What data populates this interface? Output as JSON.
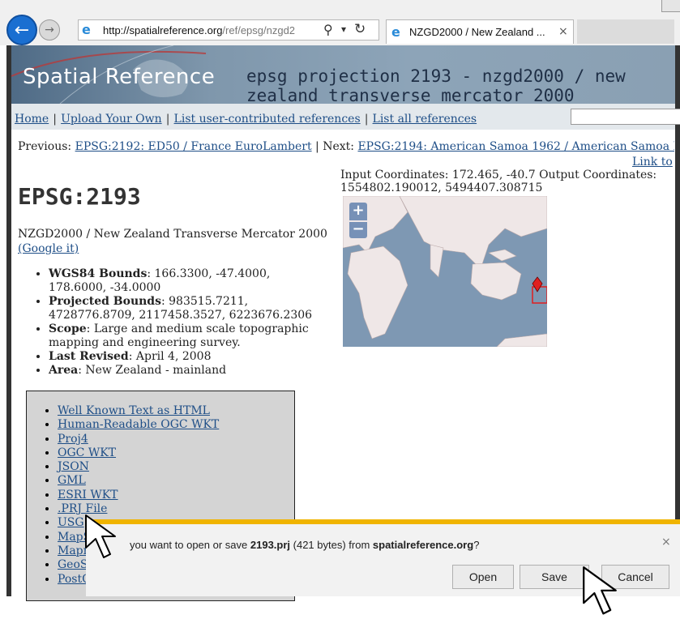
{
  "browser": {
    "url_host": "http://spatialreference.org",
    "url_path": "/ref/epsg/nzgd2",
    "tab_title": "NZGD2000 / New Zealand ...",
    "tab_close": "×"
  },
  "banner": {
    "site_title": "Spatial Reference",
    "heading": "epsg projection 2193 - nzgd2000 / new zealand transverse mercator 2000"
  },
  "nav": {
    "items": [
      {
        "label": "Home"
      },
      {
        "label": "Upload Your Own"
      },
      {
        "label": "List user-contributed references"
      },
      {
        "label": "List all references"
      }
    ],
    "separator": "|"
  },
  "pager": {
    "prev_label": "Previous:",
    "prev_link": "EPSG:2192: ED50 / France EuroLambert",
    "next_label": "| Next:",
    "next_link": "EPSG:2194: American Samoa 1962 / American Samoa Lambert",
    "link_to": "Link to"
  },
  "main": {
    "title": "EPSG:2193",
    "description": "NZGD2000 / New Zealand Transverse Mercator 2000",
    "google": "(Google it)",
    "facts": [
      {
        "key": "WGS84 Bounds",
        "value": ": 166.3300, -47.4000, 178.6000, -34.0000"
      },
      {
        "key": "Projected Bounds",
        "value": ": 983515.7211, 4728776.8709, 2117458.3527, 6223676.2306"
      },
      {
        "key": "Scope",
        "value": ": Large and medium scale topographic mapping and engineering survey."
      },
      {
        "key": "Last Revised",
        "value": ": April 4, 2008"
      },
      {
        "key": "Area",
        "value": ": New Zealand - mainland"
      }
    ],
    "coords": "Input Coordinates: 172.465, -40.7 Output Coordinates: 1554802.190012, 5494407.308715",
    "map_zoom_in": "+",
    "map_zoom_out": "−"
  },
  "exports": [
    {
      "label": "Well Known Text as HTML"
    },
    {
      "label": "Human-Readable OGC WKT"
    },
    {
      "label": "Proj4"
    },
    {
      "label": "OGC WKT"
    },
    {
      "label": "JSON"
    },
    {
      "label": "GML"
    },
    {
      "label": "ESRI WKT"
    },
    {
      "label": ".PRJ File"
    },
    {
      "label": "USG"
    },
    {
      "label": "MapS"
    },
    {
      "label": "Mapr"
    },
    {
      "label": "GeoS"
    },
    {
      "label": "PostG"
    }
  ],
  "download": {
    "text_pre": "you want to open or save ",
    "filename": "2193.prj",
    "text_mid": " (421 bytes) from ",
    "source": "spatialreference.org",
    "text_post": "?",
    "open": "Open",
    "save": "Save",
    "cancel": "Cancel",
    "close": "×"
  },
  "colors": {
    "link": "#1e4e87",
    "notification_accent": "#f0b400",
    "ie_blue": "#1a6fd1"
  }
}
